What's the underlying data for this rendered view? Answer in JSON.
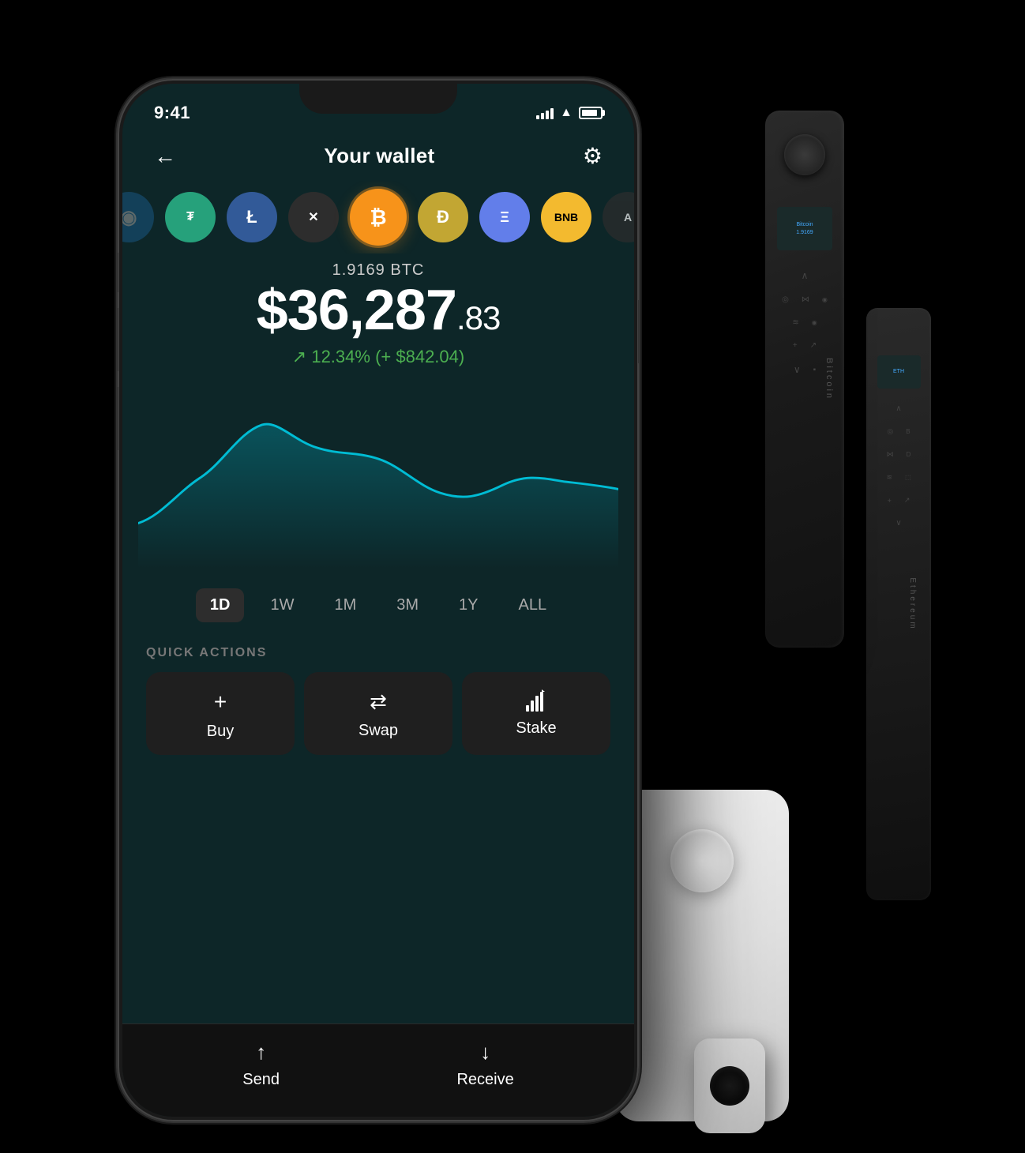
{
  "status": {
    "time": "9:41",
    "battery_level": 85
  },
  "header": {
    "title": "Your wallet",
    "back_label": "←",
    "settings_label": "⚙"
  },
  "crypto_row": [
    {
      "id": "partial",
      "symbol": "◉",
      "class": "partial-left"
    },
    {
      "id": "tether",
      "symbol": "₮",
      "class": "tether"
    },
    {
      "id": "litecoin",
      "symbol": "Ł",
      "class": "litecoin"
    },
    {
      "id": "xrp",
      "symbol": "✕",
      "class": "xrp"
    },
    {
      "id": "bitcoin",
      "symbol": "₿",
      "class": "bitcoin"
    },
    {
      "id": "doge",
      "symbol": "Ð",
      "class": "doge"
    },
    {
      "id": "ethereum",
      "symbol": "Ξ",
      "class": "ethereum"
    },
    {
      "id": "bnb",
      "symbol": "BNB",
      "class": "bnb"
    },
    {
      "id": "algo",
      "symbol": "A",
      "class": "algo"
    }
  ],
  "balance": {
    "crypto_amount": "1.9169 BTC",
    "fiat_amount": "$36,287",
    "fiat_cents": ".83",
    "change_percent": "12.34%",
    "change_amount": "+ $842.04",
    "change_arrow": "↗"
  },
  "time_filters": [
    {
      "label": "1D",
      "active": true
    },
    {
      "label": "1W",
      "active": false
    },
    {
      "label": "1M",
      "active": false
    },
    {
      "label": "3M",
      "active": false
    },
    {
      "label": "1Y",
      "active": false
    },
    {
      "label": "ALL",
      "active": false
    }
  ],
  "quick_actions": {
    "section_label": "QUICK ACTIONS",
    "actions": [
      {
        "id": "buy",
        "icon": "+",
        "label": "Buy"
      },
      {
        "id": "swap",
        "icon": "⇄",
        "label": "Swap"
      },
      {
        "id": "stake",
        "icon": "↑↑",
        "label": "Stake"
      }
    ]
  },
  "bottom_actions": [
    {
      "id": "send",
      "icon": "↑",
      "label": "Send"
    },
    {
      "id": "receive",
      "icon": "↓",
      "label": "Receive"
    }
  ],
  "ledger": {
    "nano_x_label": "Bitcoin",
    "nano_s_label": "Ethereum"
  },
  "colors": {
    "background": "#000000",
    "phone_bg": "#0d2628",
    "accent_green": "#4CAF50",
    "chart_line": "#00BCD4",
    "active_filter_bg": "#2d2d2d"
  }
}
